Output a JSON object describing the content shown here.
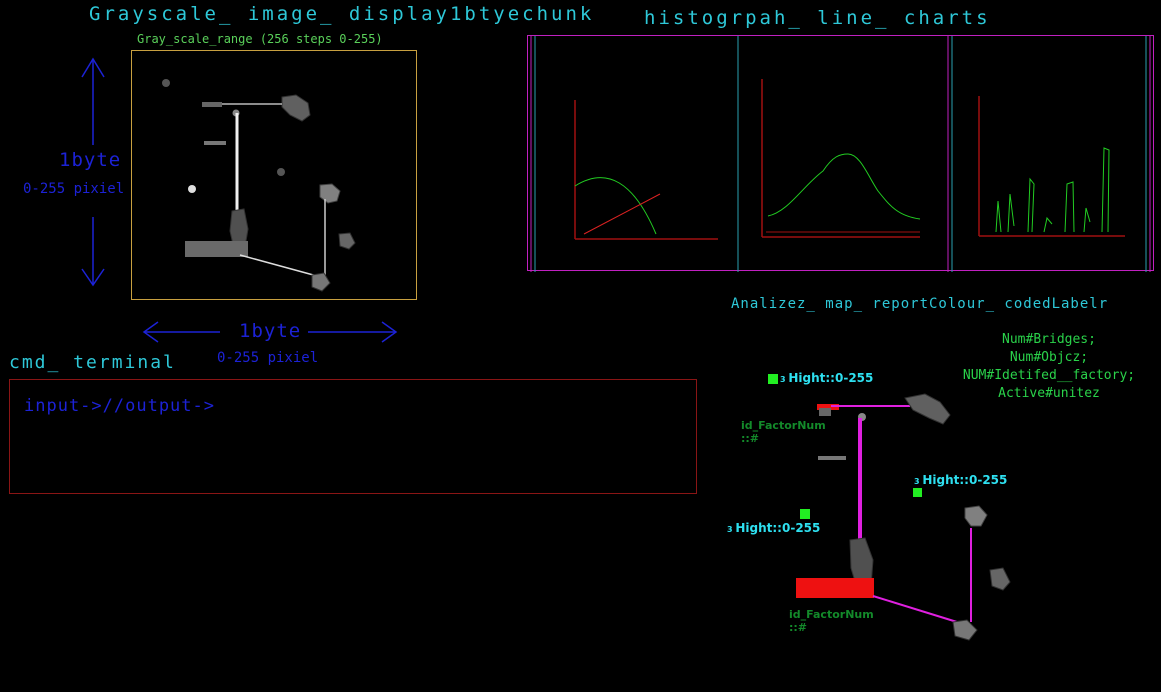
{
  "grayscale": {
    "title": "Grayscale_ image_ display1btyechunk",
    "range_label": "Gray_scale_range (256 steps 0-255)",
    "y_axis": {
      "title": "1byte",
      "subtitle": "0-255 pixiel"
    },
    "x_axis": {
      "title": "1byte",
      "subtitle": "0-255 pixiel"
    }
  },
  "histogram": {
    "title": "histogrpah_ line_ charts"
  },
  "terminal": {
    "title": "cmd_ terminal",
    "line": "input->//output->"
  },
  "report": {
    "title": "Analizez_ map_ reportColour_ codedLabelr",
    "legend": [
      "Num#Bridges;",
      "Num#Objcz;",
      "NUM#Idetifed__factory;",
      "Active#unitez"
    ],
    "hight_label_1": "Hight::0-255",
    "hight_label_2": "Hight::0-255",
    "hight_label_3": "Hight::0-255",
    "factor_1_line1": "id_FactorNum",
    "factor_1_line2": "::#",
    "factor_2_line1": "id_FactorNum",
    "factor_2_line2": "::#"
  },
  "colors": {
    "title_cyan": "#2ec8d8",
    "axis_blue": "#1c22d6",
    "hist_border": "#c020c0",
    "chart_axis": "#a01010",
    "chart_line": "#22cc22",
    "highlight_magenta": "#e020e0",
    "highlight_red": "#ee1111",
    "marker_green": "#22ee22"
  }
}
